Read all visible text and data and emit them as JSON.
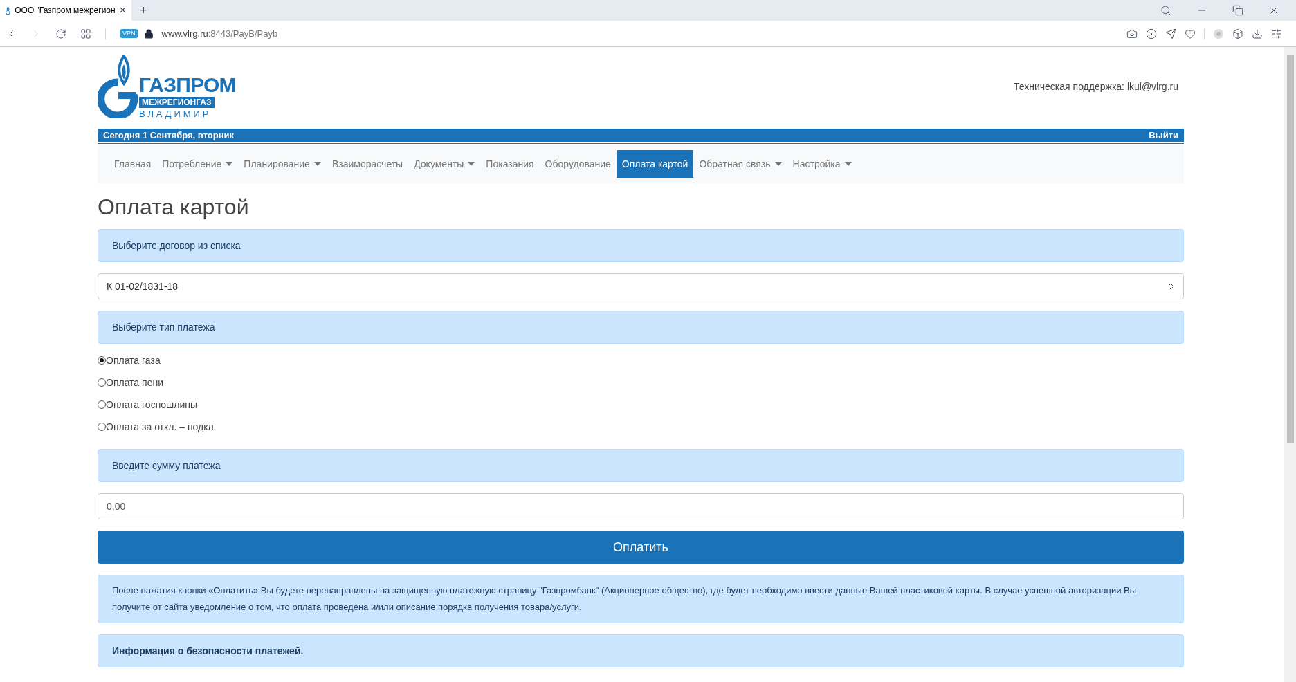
{
  "browser": {
    "tab": {
      "title": "ООО \"Газпром межрегион",
      "close": "×"
    },
    "new_tab": "+",
    "vpn": "VPN",
    "url_host": "www.vlrg.ru",
    "url_rest": ":8443/PayB/Payb"
  },
  "header": {
    "logo": {
      "line1": "ГАЗПРОМ",
      "line2": "МЕЖРЕГИОНГАЗ",
      "line3": "ВЛАДИМИР"
    },
    "support": "Техническая поддержка: lkul@vlrg.ru"
  },
  "date_bar": {
    "date": "Сегодня 1 Сентября, вторник",
    "logout": "Выйти"
  },
  "nav": [
    {
      "label": "Главная",
      "dropdown": false,
      "selected": false
    },
    {
      "label": "Потребление",
      "dropdown": true,
      "selected": false
    },
    {
      "label": "Планирование",
      "dropdown": true,
      "selected": false
    },
    {
      "label": "Взаиморасчеты",
      "dropdown": false,
      "selected": false
    },
    {
      "label": "Документы",
      "dropdown": true,
      "selected": false
    },
    {
      "label": "Показания",
      "dropdown": false,
      "selected": false
    },
    {
      "label": "Оборудование",
      "dropdown": false,
      "selected": false
    },
    {
      "label": "Оплата картой",
      "dropdown": false,
      "selected": true
    },
    {
      "label": "Обратная связь",
      "dropdown": true,
      "selected": false
    },
    {
      "label": "Настройка",
      "dropdown": true,
      "selected": false
    }
  ],
  "page_title": "Оплата картой",
  "contract_prompt": "Выберите договор из списка",
  "contract_select": {
    "value": "К 01-02/1831-18"
  },
  "payment_type_prompt": "Выберите тип платежа",
  "payment_types": [
    {
      "label": "Оплата газа",
      "selected": true
    },
    {
      "label": "Оплата пени",
      "selected": false
    },
    {
      "label": "Оплата госпошлины",
      "selected": false
    },
    {
      "label": "Оплата за откл. – подкл.",
      "selected": false
    }
  ],
  "amount_prompt": "Введите сумму платежа",
  "amount_field": {
    "value": "0,00"
  },
  "pay_button": "Оплатить",
  "notice": "После нажатия кнопки «Оплатить» Вы будете перенаправлены на защищенную платежную страницу \"Газпромбанк\" (Акционерное общество), где будет необходимо ввести данные Вашей пластиковой карты. В случае успешной авторизации Вы получите от сайта уведомление о том, что оплата проведена и/или описание порядка получения товара/услуги.",
  "security_heading": "Информация о безопасности платежей."
}
